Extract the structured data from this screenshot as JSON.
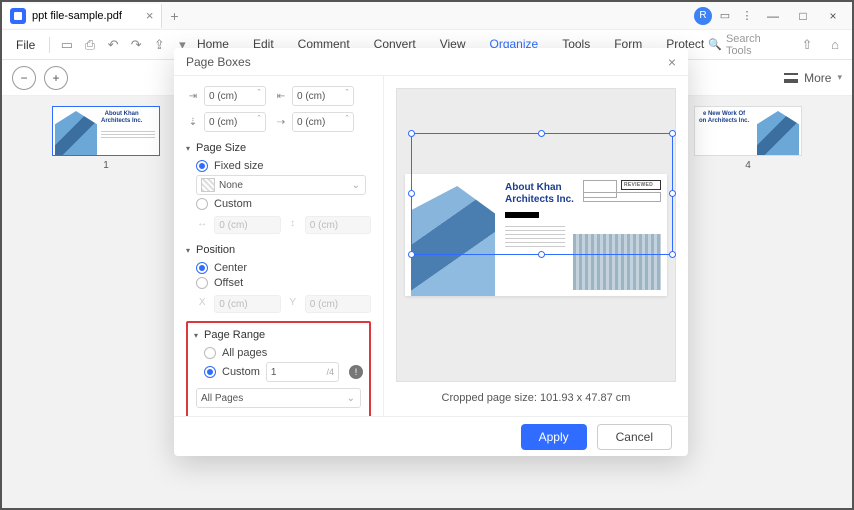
{
  "titlebar": {
    "tab_name": "ppt file-sample.pdf",
    "badge": "R"
  },
  "menubar": {
    "file": "File",
    "items": [
      "Home",
      "Edit",
      "Comment",
      "Convert",
      "View",
      "Organize",
      "Tools",
      "Form",
      "Protect"
    ],
    "active_index": 5,
    "search_placeholder": "Search Tools"
  },
  "toolbar2": {
    "more": "More"
  },
  "thumbs": {
    "left": {
      "title": "About Khan\nArchitects Inc.",
      "num": "1"
    },
    "right": {
      "title": "e New Work Of\non Architects Inc.",
      "num": "4"
    }
  },
  "dialog": {
    "title": "Page Boxes",
    "margins": {
      "top": "0 (cm)",
      "bottom": "0 (cm)",
      "left": "0 (cm)",
      "right": "0 (cm)"
    },
    "page_size": {
      "head": "Page Size",
      "fixed_label": "Fixed size",
      "none": "None",
      "custom_label": "Custom",
      "w": "0 (cm)",
      "h": "0 (cm)"
    },
    "position": {
      "head": "Position",
      "center": "Center",
      "offset": "Offset",
      "x": "0 (cm)",
      "y": "0 (cm)"
    },
    "page_range": {
      "head": "Page Range",
      "all": "All pages",
      "custom": "Custom",
      "custom_value": "1",
      "custom_total": "/4",
      "subset": "All Pages"
    },
    "preview": {
      "title": "About Khan\nArchitects Inc.",
      "reviewed": "REVIEWED",
      "crop_label": "Cropped page size: 101.93 x 47.87 cm"
    },
    "buttons": {
      "apply": "Apply",
      "cancel": "Cancel"
    }
  }
}
